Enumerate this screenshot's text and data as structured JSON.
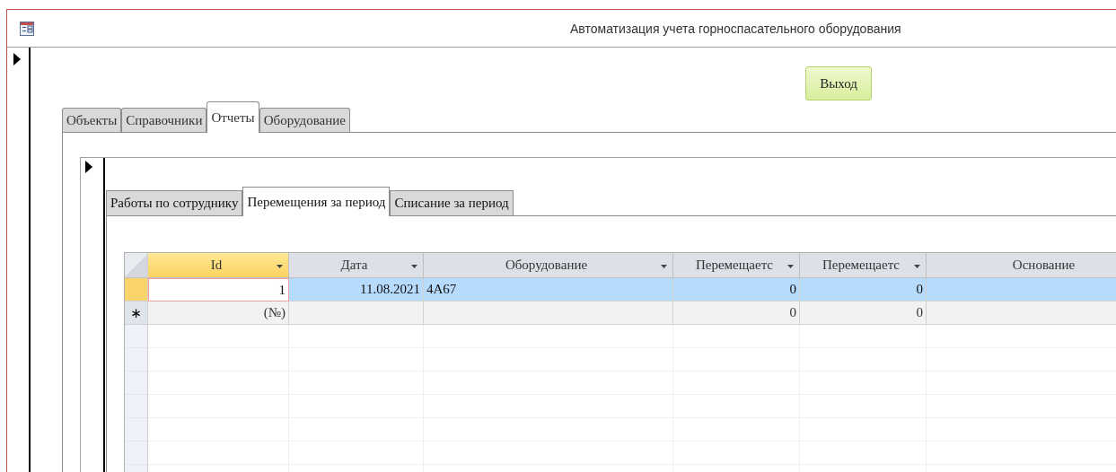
{
  "window": {
    "title": "Автоматизация учета горноспасательного оборудования"
  },
  "exit_button": {
    "label": "Выход"
  },
  "tabs": [
    {
      "label": "Объекты",
      "selected": false
    },
    {
      "label": "Справочники",
      "selected": false
    },
    {
      "label": "Отчеты",
      "selected": true
    },
    {
      "label": "Оборудование",
      "selected": false
    }
  ],
  "subtabs": [
    {
      "label": "Работы по сотруднику",
      "selected": false
    },
    {
      "label": "Перемещения за период",
      "selected": true
    },
    {
      "label": "Списание за период",
      "selected": false
    }
  ],
  "table": {
    "columns": [
      {
        "label": "Id",
        "filter_arrow": true,
        "selected": true
      },
      {
        "label": "Дата",
        "filter_arrow": true,
        "selected": false
      },
      {
        "label": "Оборудование",
        "filter_arrow": true,
        "selected": false
      },
      {
        "label": "Перемещаетс",
        "filter_arrow": true,
        "selected": false
      },
      {
        "label": "Перемещаетс",
        "filter_arrow": true,
        "selected": false
      },
      {
        "label": "Основание",
        "selected": false
      }
    ],
    "rows": [
      {
        "kind": "record",
        "selected": true,
        "cells": [
          "1",
          "11.08.2021",
          "4А67",
          "0",
          "0",
          null
        ]
      },
      {
        "kind": "new",
        "selected": false,
        "marker": "∗",
        "cells": [
          "(№)",
          null,
          null,
          "0",
          "0",
          null
        ]
      }
    ]
  }
}
